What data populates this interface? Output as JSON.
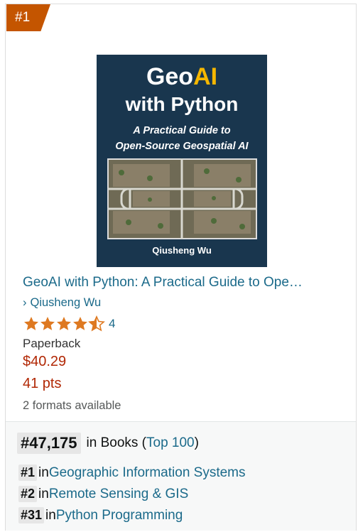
{
  "badge": "#1",
  "cover": {
    "title_part1": "Geo",
    "title_part2": "AI",
    "title_line2": "with Python",
    "subtitle_line1": "A Practical Guide to",
    "subtitle_line2": "Open-Source Geospatial AI",
    "author": "Qiusheng Wu"
  },
  "product": {
    "title": "GeoAI with Python: A Practical Guide to Ope…",
    "author_chevron": "›",
    "author": "Qiusheng Wu",
    "rating": 4.5,
    "rating_count": "4",
    "format": "Paperback",
    "price": "$40.29",
    "points": "41 pts",
    "formats_available": "2 formats available"
  },
  "ranking": {
    "main_rank": "#47,175",
    "main_in": "in Books (",
    "main_link": "Top 100",
    "main_close": ")",
    "sub": [
      {
        "rank": "#1",
        "in": "in",
        "category": "Geographic Information Systems"
      },
      {
        "rank": "#2",
        "in": "in",
        "category": "Remote Sensing & GIS"
      },
      {
        "rank": "#31",
        "in": "in",
        "category": "Python Programming"
      }
    ]
  },
  "colors": {
    "badge": "#c45500",
    "link": "#1b6a8a",
    "price": "#b12704",
    "star": "#de7921"
  }
}
